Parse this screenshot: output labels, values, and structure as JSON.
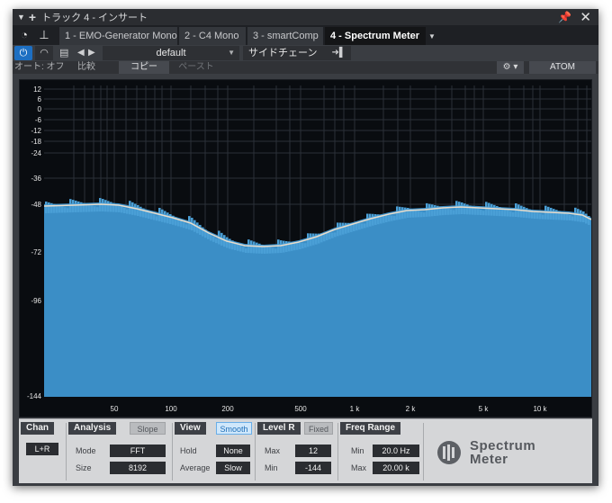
{
  "titlebar": {
    "title": "トラック 4 - インサート",
    "expand_icon": "triangle-down-icon",
    "add_icon": "plus-icon",
    "pin_icon": "pin-icon",
    "close_icon": "close-icon"
  },
  "tabs": [
    {
      "label": "1 - EMO-Generator Mono",
      "active": false
    },
    {
      "label": "2 - C4 Mono",
      "active": false
    },
    {
      "label": "3 - smartComp",
      "active": false
    },
    {
      "label": "4 - Spectrum Meter",
      "active": true
    }
  ],
  "preset": {
    "name": "default",
    "sidechain_label": "サイドチェーン"
  },
  "autorow": {
    "auto_label": "オート: オフ",
    "compare_label": "比較",
    "copy_label": "コピー",
    "paste_label": "ペースト",
    "atom_label": "ATOM"
  },
  "spectrum": {
    "y_ticks": [
      "12",
      "6",
      "0",
      "-6",
      "-12",
      "-18",
      "-24",
      "-36",
      "-48",
      "-72",
      "-96",
      "-144"
    ],
    "x_ticks": [
      "50",
      "100",
      "200",
      "500",
      "1 k",
      "2 k",
      "5 k",
      "10 k"
    ],
    "colors": {
      "fill": "#3b8ec6",
      "fill_top": "#4a9fd6",
      "curve": "#e8dccb",
      "grid": "#2a3038",
      "bg": "#090c10"
    }
  },
  "controls": {
    "chan": {
      "title": "Chan",
      "value": "L+R"
    },
    "analysis": {
      "title": "Analysis",
      "slope_label": "Slope",
      "mode_label": "Mode",
      "mode_value": "FFT",
      "size_label": "Size",
      "size_value": "8192"
    },
    "view": {
      "title": "View",
      "smooth_label": "Smooth",
      "hold_label": "Hold",
      "hold_value": "None",
      "average_label": "Average",
      "average_value": "Slow"
    },
    "level": {
      "title": "Level R",
      "fixed_label": "Fixed",
      "max_label": "Max",
      "max_value": "12",
      "min_label": "Min",
      "min_value": "-144"
    },
    "freq": {
      "title": "Freq Range",
      "min_label": "Min",
      "min_value": "20.0 Hz",
      "max_label": "Max",
      "max_value": "20.00 k"
    }
  },
  "logo": {
    "line1": "Spectrum",
    "line2": "Meter"
  }
}
